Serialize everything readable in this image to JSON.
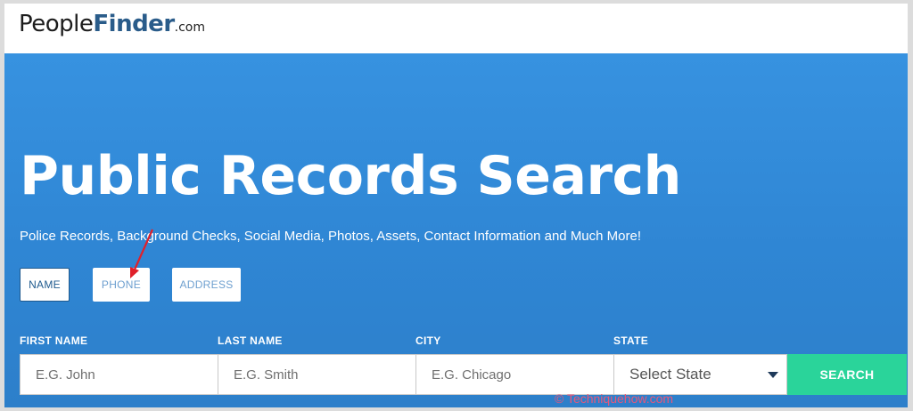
{
  "logo": {
    "part1": "People",
    "part2": "Finder",
    "part3": ".com"
  },
  "hero": {
    "title": "Public Records Search",
    "subtitle": "Police Records, Background Checks, Social Media, Photos, Assets, Contact Information and Much More!"
  },
  "tabs": [
    {
      "label": "NAME",
      "active": true
    },
    {
      "label": "PHONE",
      "active": false
    },
    {
      "label": "ADDRESS",
      "active": false
    }
  ],
  "form": {
    "first_name": {
      "label": "FIRST NAME",
      "placeholder": "E.G. John",
      "value": ""
    },
    "last_name": {
      "label": "LAST NAME",
      "placeholder": "E.G. Smith",
      "value": ""
    },
    "city": {
      "label": "CITY",
      "placeholder": "E.G. Chicago",
      "value": ""
    },
    "state": {
      "label": "STATE",
      "selected": "Select State"
    },
    "search_label": "SEARCH"
  },
  "watermark": "© Techniquehow.com",
  "colors": {
    "hero_blue": "#3792e0",
    "logo_accent": "#2a5c8a",
    "search_green": "#2ad49a",
    "annotation_red": "#e0202a"
  }
}
